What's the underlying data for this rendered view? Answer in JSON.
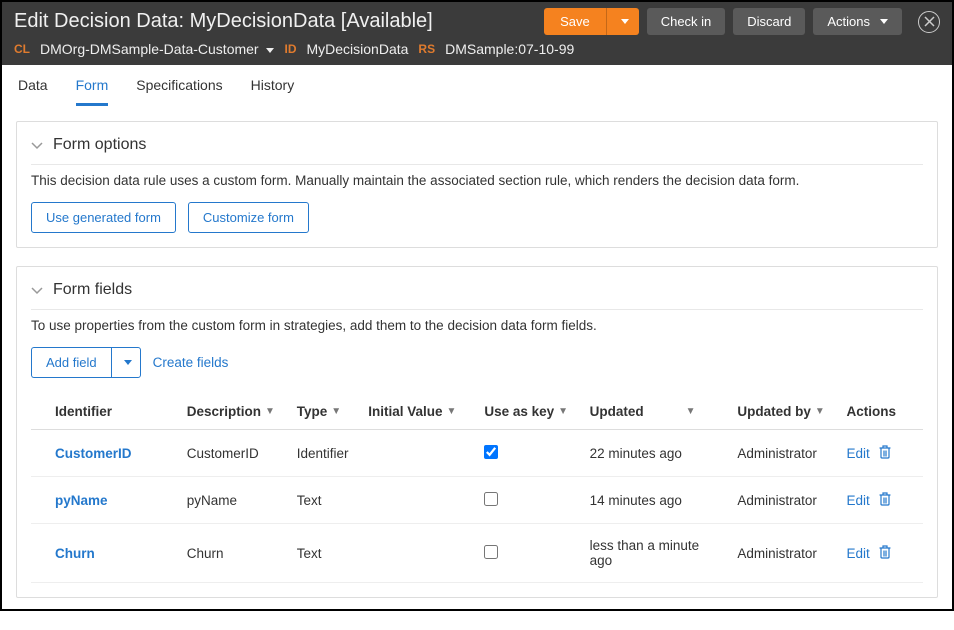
{
  "header": {
    "title_prefix": "Edit Decision Data: ",
    "title_name": "MyDecisionData",
    "title_status": " [Available]",
    "save_label": "Save",
    "checkin_label": "Check in",
    "discard_label": "Discard",
    "actions_label": "Actions",
    "meta": {
      "cl_label": "CL",
      "cl_value": "DMOrg-DMSample-Data-Customer",
      "id_label": "ID",
      "id_value": "MyDecisionData",
      "rs_label": "RS",
      "rs_value": "DMSample:07-10-99"
    }
  },
  "tabs": {
    "data": "Data",
    "form": "Form",
    "specs": "Specifications",
    "history": "History"
  },
  "form_options": {
    "title": "Form options",
    "description": "This decision data rule uses a custom form.  Manually maintain the associated section rule, which renders the decision data form.",
    "use_generated": "Use generated form",
    "customize": "Customize form"
  },
  "form_fields": {
    "title": "Form fields",
    "description": "To use properties from the custom form in strategies, add them to the decision data form fields.",
    "add_field": "Add field",
    "create_fields": "Create fields",
    "columns": {
      "identifier": "Identifier",
      "description": "Description",
      "type": "Type",
      "initial_value": "Initial Value",
      "use_as_key": "Use as key",
      "updated": "Updated",
      "updated_by": "Updated by",
      "actions": "Actions"
    },
    "rows": [
      {
        "identifier": "CustomerID",
        "description": "CustomerID",
        "type": "Identifier",
        "initial_value": "",
        "use_as_key": true,
        "updated": "22 minutes ago",
        "updated_by": "Administrator",
        "action": "Edit"
      },
      {
        "identifier": "pyName",
        "description": "pyName",
        "type": "Text",
        "initial_value": "",
        "use_as_key": false,
        "updated": "14 minutes ago",
        "updated_by": "Administrator",
        "action": "Edit"
      },
      {
        "identifier": "Churn",
        "description": "Churn",
        "type": "Text",
        "initial_value": "",
        "use_as_key": false,
        "updated": "less than a minute ago",
        "updated_by": "Administrator",
        "action": "Edit"
      }
    ]
  }
}
